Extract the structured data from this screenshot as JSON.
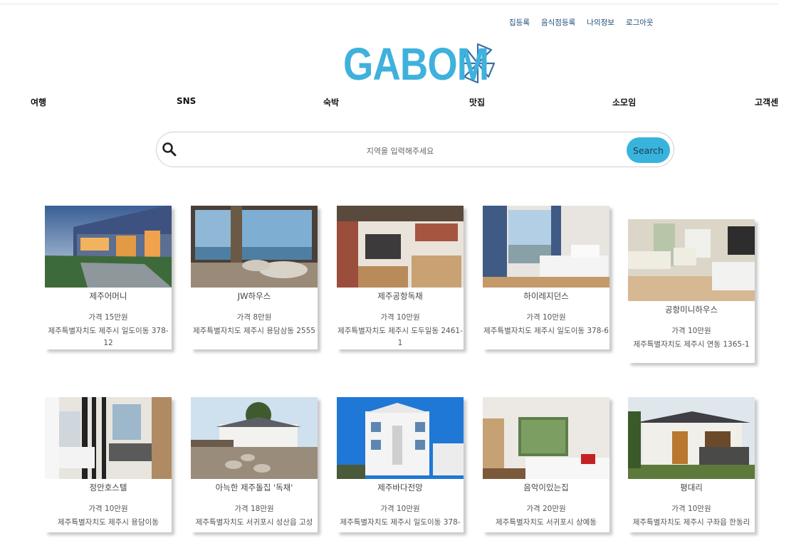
{
  "util_links": [
    "집등록",
    "음식점등록",
    "나의정보",
    "로그아웃"
  ],
  "logo": {
    "text": "GABOM",
    "color": "#3fb1dd"
  },
  "nav": [
    "여행",
    "SNS",
    "숙박",
    "맛집",
    "소모임",
    "고객센"
  ],
  "search": {
    "icon": "search-icon",
    "placeholder": "지역을 입력해주세요",
    "button": "Search"
  },
  "listings": [
    {
      "name": "제주어머니",
      "price": "가격 15만원",
      "address": "제주특별자치도 제주시 일도이동 378-12"
    },
    {
      "name": "JW하우스",
      "price": "가격 8만원",
      "address": "제주특별자치도 제주시 용담삼동 2555"
    },
    {
      "name": "제주공항독채",
      "price": "가격 10만원",
      "address": "제주특별자치도 제주시 도두일동 2461-1"
    },
    {
      "name": "하이레지던스",
      "price": "가격 10만원",
      "address": "제주특별자치도 제주시 일도이동 378-6"
    },
    {
      "name": "공항미니하우스",
      "price": "가격 10만원",
      "address": "제주특별자치도 제주시 연동 1365-1"
    },
    {
      "name": "정안호스텔",
      "price": "가격 10만원",
      "address": "제주특별자치도 제주시 용담이동"
    },
    {
      "name": "아늑한 제주돌집 '독채'",
      "price": "가격 18만원",
      "address": "제주특별자치도 서귀포시 성산읍 고성"
    },
    {
      "name": "제주바다전망",
      "price": "가격 10만원",
      "address": "제주특별자치도 제주시 일도이동 378-"
    },
    {
      "name": "음악이있는집",
      "price": "가격 20만원",
      "address": "제주특별자치도 서귀포시 상예동"
    },
    {
      "name": "평대리",
      "price": "가격 10만원",
      "address": "제주특별자치도 제주시 구좌읍 한동리"
    }
  ]
}
